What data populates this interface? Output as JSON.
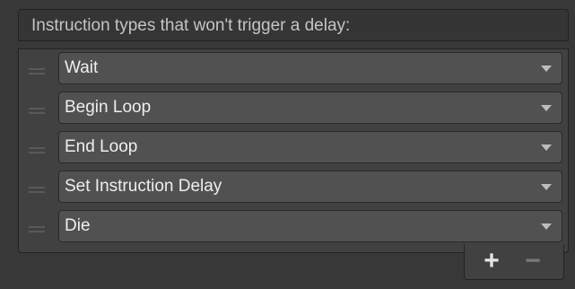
{
  "list": {
    "header_label": "Instruction types that won't trigger a delay:",
    "items": [
      {
        "value": "Wait"
      },
      {
        "value": "Begin Loop"
      },
      {
        "value": "End Loop"
      },
      {
        "value": "Set Instruction Delay"
      },
      {
        "value": "Die"
      }
    ],
    "add_icon": "+",
    "remove_icon": "−"
  },
  "icons": {
    "drag_handle": "drag-handle-icon",
    "dropdown_arrow": "chevron-down-icon",
    "add": "plus-icon",
    "remove": "minus-icon"
  },
  "colors": {
    "background": "#383838",
    "header_background": "#353535",
    "body_background": "#414141",
    "dropdown_background": "#515151",
    "text": "#eeeeee",
    "header_text": "#c4c4c4",
    "disabled_text": "#7a7a7a"
  }
}
